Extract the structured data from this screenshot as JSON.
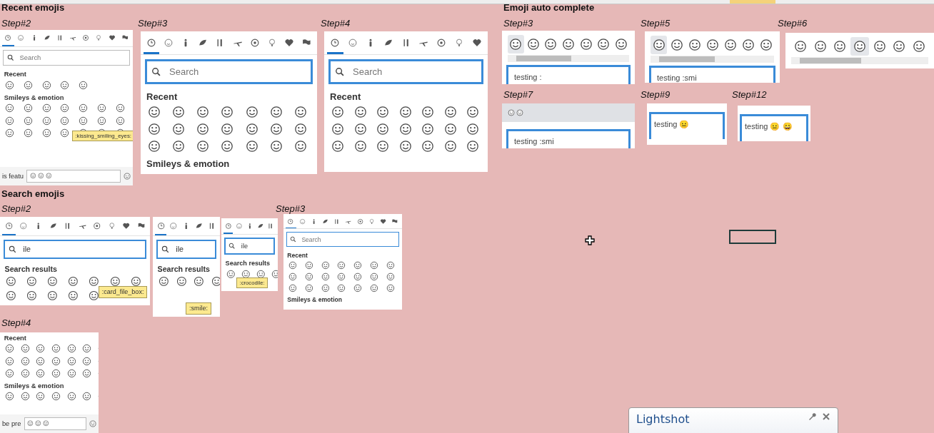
{
  "sections": [
    {
      "title": "Recent emojis",
      "steps": [
        {
          "label": "Step#2",
          "clips": [
            {
              "kind": "picker",
              "tabs": [
                {
                  "selected": true
                },
                {
                  "selected": false
                },
                {
                  "selected": false
                },
                {
                  "selected": false
                },
                {
                  "selected": false
                },
                {
                  "selected": false
                },
                {
                  "selected": false
                },
                {
                  "selected": false
                },
                {
                  "selected": false
                },
                {
                  "selected": false
                }
              ],
              "search": {
                "placeholder": "Search",
                "focused": false
              },
              "groups": [
                "Recent",
                "Smileys & emotion"
              ],
              "tooltip": ":kissing_smiling_eyes:",
              "footer": {
                "edge_text": "is featu"
              }
            }
          ]
        },
        {
          "label": "Step#3",
          "clips": [
            {
              "kind": "picker",
              "tabs": [
                {
                  "selected": true
                },
                {
                  "selected": false
                },
                {
                  "selected": false
                },
                {
                  "selected": false
                },
                {
                  "selected": false
                },
                {
                  "selected": false
                },
                {
                  "selected": false
                },
                {
                  "selected": false
                },
                {
                  "selected": false
                },
                {
                  "selected": false
                }
              ],
              "search": {
                "placeholder": "Search",
                "focused": true
              },
              "groups": [
                "Recent",
                "Smileys & emotion"
              ]
            }
          ]
        },
        {
          "label": "Step#4",
          "clips": [
            {
              "kind": "picker",
              "tabs": [
                {
                  "selected": true
                },
                {
                  "selected": false
                },
                {
                  "selected": false
                },
                {
                  "selected": false
                },
                {
                  "selected": false
                },
                {
                  "selected": false
                },
                {
                  "selected": false
                },
                {
                  "selected": false
                },
                {
                  "selected": false
                }
              ],
              "search": {
                "placeholder": "Search",
                "focused": true
              },
              "groups": [
                "Recent"
              ]
            }
          ]
        }
      ]
    },
    {
      "title": "Emoji auto complete",
      "steps": [
        {
          "label": "Step#3",
          "clips": [
            {
              "kind": "autocomplete",
              "emojis": [
                {
                  "selected": true
                },
                {
                  "selected": false
                },
                {
                  "selected": false
                },
                {
                  "selected": false
                },
                {
                  "selected": false
                },
                {
                  "selected": false
                },
                {
                  "selected": false
                }
              ],
              "text": "testing :"
            }
          ]
        },
        {
          "label": "Step#5",
          "clips": [
            {
              "kind": "autocomplete",
              "emojis": [
                {
                  "selected": true
                },
                {
                  "selected": false
                },
                {
                  "selected": false
                },
                {
                  "selected": false
                },
                {
                  "selected": false
                },
                {
                  "selected": false
                },
                {
                  "selected": false
                }
              ],
              "text": "testing :smi"
            }
          ]
        },
        {
          "label": "Step#6",
          "clips": [
            {
              "kind": "strip",
              "emojis": [
                {
                  "selected": false
                },
                {
                  "selected": false
                },
                {
                  "selected": false
                },
                {
                  "selected": true
                },
                {
                  "selected": false
                },
                {
                  "selected": false
                },
                {
                  "selected": false
                }
              ]
            }
          ]
        },
        {
          "label": "Step#7",
          "clips": [
            {
              "kind": "bar",
              "text": "testing :smi"
            }
          ]
        },
        {
          "label": "Step#9",
          "clips": [
            {
              "kind": "textbox",
              "text": "testing 😐"
            }
          ]
        },
        {
          "label": "Step#12",
          "clips": [
            {
              "kind": "textbox",
              "text": "testing 😐 😄"
            }
          ]
        }
      ]
    },
    {
      "title": "Search emojis",
      "steps": [
        {
          "label": "Step#2",
          "clips": [
            {
              "kind": "picker",
              "tabs": [
                {
                  "selected": true
                },
                {
                  "selected": false
                },
                {
                  "selected": false
                },
                {
                  "selected": false
                },
                {
                  "selected": false
                },
                {
                  "selected": false
                },
                {
                  "selected": false
                },
                {
                  "selected": false
                },
                {
                  "selected": false
                },
                {
                  "selected": false
                }
              ],
              "search": {
                "value": "ile",
                "focused": true
              },
              "groups": [
                "Search results"
              ],
              "tooltip": ":card_file_box:"
            },
            {
              "kind": "picker",
              "tabs": [
                {
                  "selected": true
                },
                {
                  "selected": false
                },
                {
                  "selected": false
                },
                {
                  "selected": false
                },
                {
                  "selected": false
                }
              ],
              "search": {
                "value": "ile",
                "focused": true
              },
              "groups": [
                "Search results"
              ],
              "tooltip": ":smile:"
            },
            {
              "kind": "picker",
              "tabs": [
                {
                  "selected": true
                },
                {
                  "selected": false
                },
                {
                  "selected": false
                },
                {
                  "selected": false
                },
                {
                  "selected": false
                }
              ],
              "search": {
                "value": "ile",
                "focused": true
              },
              "groups": [
                "Search results"
              ],
              "tooltip": ":crocodile:"
            }
          ]
        },
        {
          "label": "Step#3",
          "clips": [
            {
              "kind": "picker",
              "tabs": [
                {
                  "selected": true
                },
                {
                  "selected": false
                },
                {
                  "selected": false
                },
                {
                  "selected": false
                },
                {
                  "selected": false
                },
                {
                  "selected": false
                },
                {
                  "selected": false
                },
                {
                  "selected": false
                },
                {
                  "selected": false
                },
                {
                  "selected": false
                }
              ],
              "search": {
                "placeholder": "Search",
                "focused": true
              },
              "groups": [
                "Recent",
                "Smileys & emotion"
              ]
            }
          ]
        },
        {
          "label": "Step#4",
          "clips": [
            {
              "kind": "picker",
              "groups": [
                "Recent",
                "Smileys & emotion"
              ],
              "footer": {
                "edge_text": "be pre"
              }
            }
          ]
        }
      ]
    }
  ],
  "notification": {
    "title": "Lightshot"
  }
}
